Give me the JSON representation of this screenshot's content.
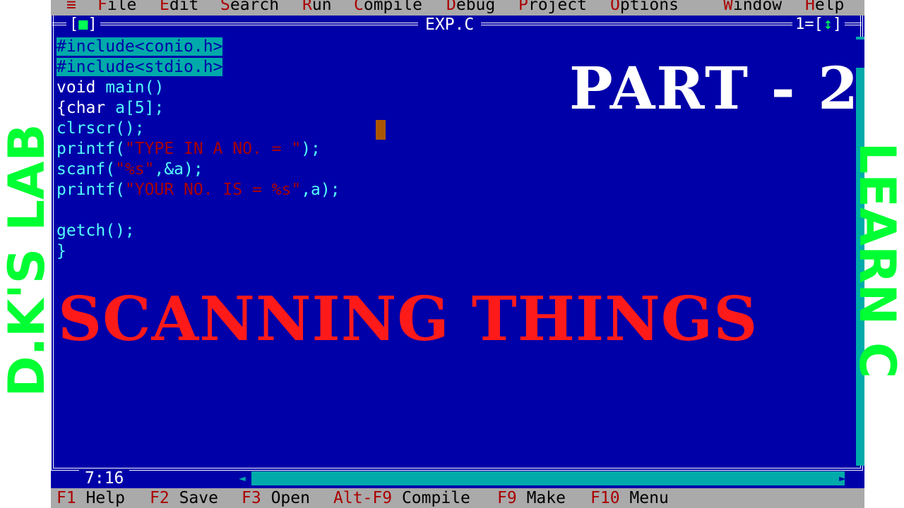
{
  "menu": {
    "system": "≡",
    "items": [
      {
        "hot": "F",
        "rest": "ile"
      },
      {
        "hot": "E",
        "rest": "dit"
      },
      {
        "hot": "S",
        "rest": "earch"
      },
      {
        "hot": "R",
        "rest": "un"
      },
      {
        "hot": "C",
        "rest": "ompile"
      },
      {
        "hot": "D",
        "rest": "ebug"
      },
      {
        "hot": "P",
        "rest": "roject"
      },
      {
        "hot": "O",
        "rest": "ptions"
      },
      {
        "hot": "W",
        "rest": "indow"
      },
      {
        "hot": "H",
        "rest": "elp"
      }
    ]
  },
  "window": {
    "title": "EXP.C",
    "close_box": "■",
    "number": "1",
    "zoom_icon": "↕"
  },
  "code": {
    "include1": "#include<conio.h>",
    "include2": "#include<stdio.h>",
    "line3_kw": "void",
    "line3_id": "main()",
    "line4a": "{char",
    "line4b": "a[5];",
    "line5": "clrscr();",
    "line6a": "printf(",
    "line6s": "\"TYPE IN A NO. = \"",
    "line6b": ");",
    "line7a": "scanf(",
    "line7s": "\"%s\"",
    "line7b": ",&a);",
    "line8a": "printf(",
    "line8s": "\"YOUR NO. IS = %s\"",
    "line8b": ",a);",
    "line9": "",
    "line10": "getch();",
    "line11": "}"
  },
  "status": {
    "position": "7:16"
  },
  "function_keys": [
    {
      "key": "F1",
      "label": "Help"
    },
    {
      "key": "F2",
      "label": "Save"
    },
    {
      "key": "F3",
      "label": "Open"
    },
    {
      "key": "Alt-F9",
      "label": "Compile"
    },
    {
      "key": "F9",
      "label": "Make"
    },
    {
      "key": "F10",
      "label": "Menu"
    }
  ],
  "overlay": {
    "part": "PART - 2",
    "subtitle": "SCANNING THINGS",
    "left_brand": "D.K'S LAB",
    "right_brand": "LEARN C"
  },
  "colors": {
    "editor_bg": "#0000a8",
    "menu_bg": "#aaaaaa",
    "hotkey": "#aa0000",
    "overlay_red": "#ff1a1a",
    "overlay_green": "#00ff33"
  }
}
